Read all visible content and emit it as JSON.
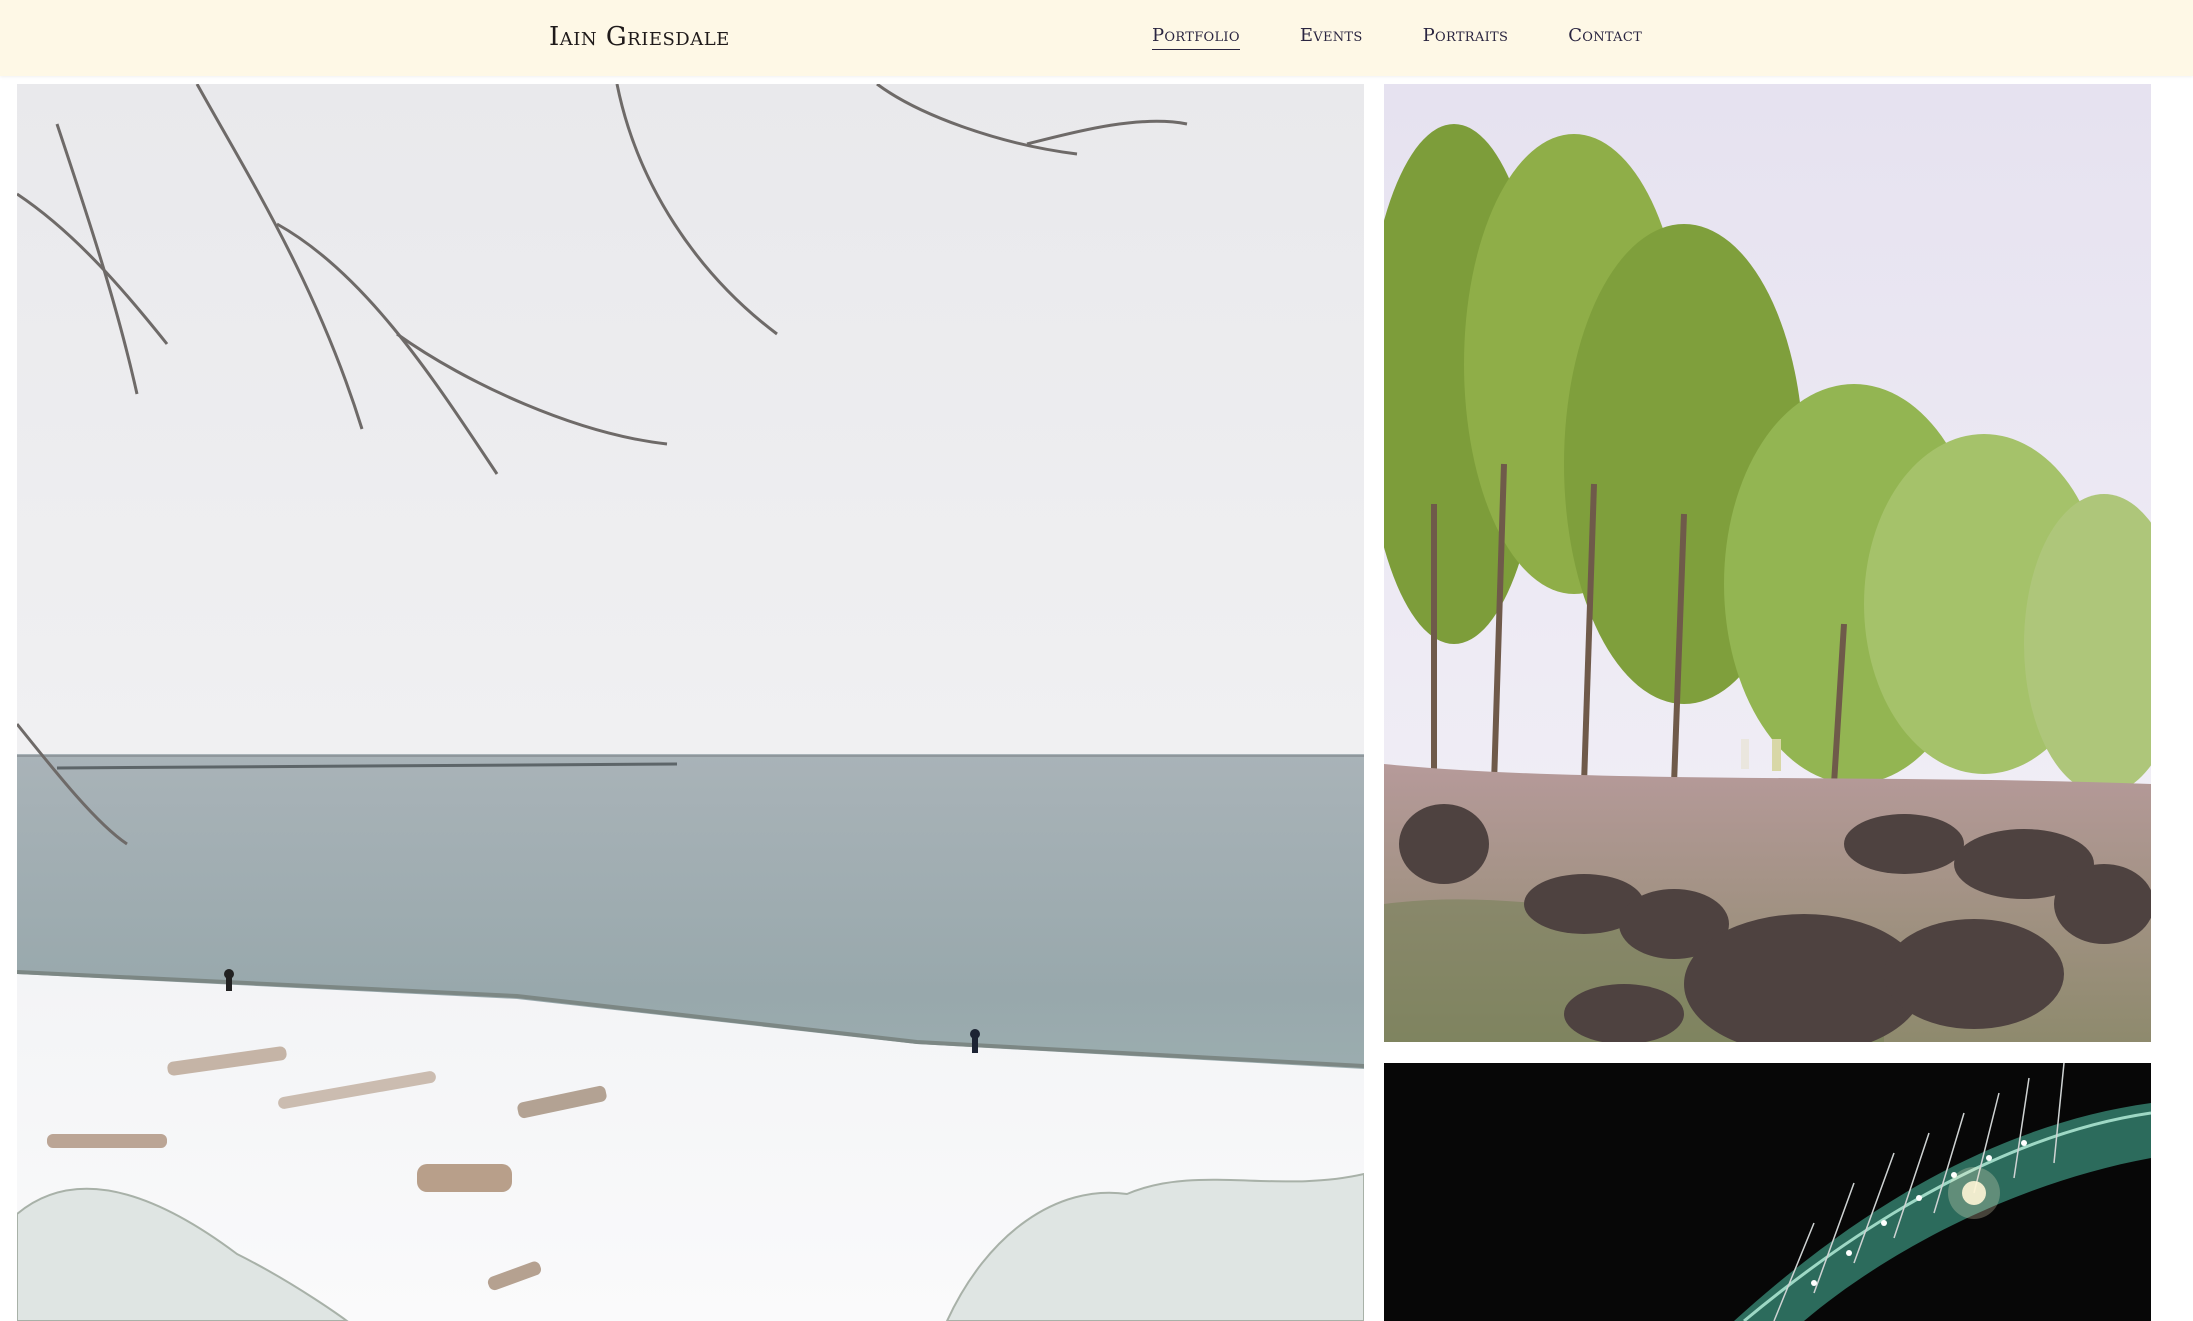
{
  "header": {
    "site_title": "Iain Griesdale",
    "nav": [
      {
        "label": "Portfolio",
        "active": true
      },
      {
        "label": "Events",
        "active": false
      },
      {
        "label": "Portraits",
        "active": false
      },
      {
        "label": "Contact",
        "active": false
      }
    ]
  },
  "colors": {
    "header_bg": "#fef8e6",
    "nav_text": "#2a2540",
    "title_text": "#1f1a1a"
  },
  "gallery": [
    {
      "subject": "snowy-beach-photo"
    },
    {
      "subject": "trees-rocky-shore-photo"
    },
    {
      "subject": "night-bridge-photo"
    }
  ]
}
